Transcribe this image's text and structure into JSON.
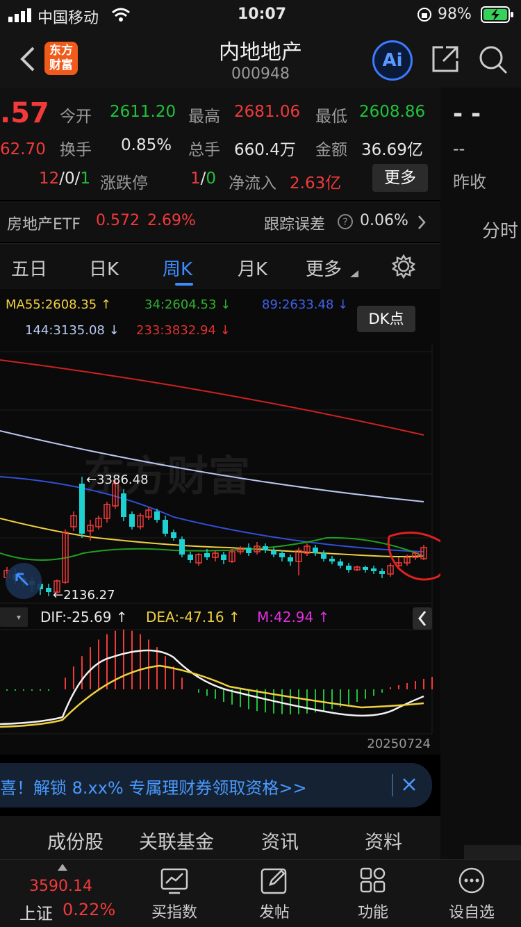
{
  "status": {
    "carrier": "中国移动",
    "time": "10:07",
    "battery": "98%"
  },
  "header": {
    "title": "内地地产",
    "code": "000948",
    "logo_line1": "东方",
    "logo_line2": "财富",
    "ai_label": "Ai"
  },
  "quote": {
    "price": ".57",
    "prev_partial": "62.70",
    "open_label": "今开",
    "open": "2611.20",
    "high_label": "最高",
    "high": "2681.06",
    "low_label": "最低",
    "low": "2608.86",
    "turnover_label": "换手",
    "turnover": "0.85%",
    "volume_label": "总手",
    "volume": "660.4万",
    "amount_label": "金额",
    "amount": "36.69亿",
    "updown_a": "12",
    "updown_sep1": "/",
    "updown_b": "0",
    "updown_sep2": "/",
    "updown_c": "1",
    "limit_label": "涨跌停",
    "limit_a": "1",
    "limit_sep": "/",
    "limit_b": "0",
    "netflow_label": "净流入",
    "netflow": "2.63亿",
    "more_button": "更多"
  },
  "right_panel": {
    "dash1": "- -",
    "dash2": "--",
    "prev_close_label": "昨收",
    "intraday_label": "分时"
  },
  "etf": {
    "name": "房地产ETF",
    "price": "0.572",
    "pct": "2.69%",
    "tracking_label": "跟踪误差",
    "tracking_value": "0.06%"
  },
  "tabs": [
    "五日",
    "日K",
    "周K",
    "月K",
    "更多"
  ],
  "ma_legend": {
    "ma55": "MA55:2608.35 ↑",
    "ma34": "34:2604.53 ↓",
    "ma89": "89:2633.48 ↓",
    "ma144": "144:3135.08 ↓",
    "ma233": "233:3832.94 ↓",
    "dk_button": "DK点"
  },
  "chart_labels": {
    "high_mark": "←3386.48",
    "low_mark": "←2136.27",
    "watermark": "东方财富",
    "date": "20250724"
  },
  "macd_legend": {
    "dif": "DIF:-25.69 ↑",
    "dea": "DEA:-47.16 ↑",
    "m": "M:42.94 ↑"
  },
  "banner": {
    "text": "喜！解锁 8.xx% 专属理财券领取资格>>"
  },
  "subtabs": [
    "成份股",
    "关联基金",
    "资讯",
    "资料"
  ],
  "bottom": {
    "index_value": "3590.14",
    "index_name": "上证",
    "index_pct": "0.22%",
    "nav1": "买指数",
    "nav2": "发帖",
    "nav3": "功能",
    "nav4": "设自选"
  },
  "colors": {
    "up": "#f23a3a",
    "down": "#21c23b",
    "candle_down": "#1fd0d0",
    "accent": "#3d7bff",
    "ma55": "#f0d040",
    "ma34": "#1fa01f",
    "ma89": "#3050d8",
    "ma144": "#b8c8f0",
    "ma233": "#d02020"
  }
}
